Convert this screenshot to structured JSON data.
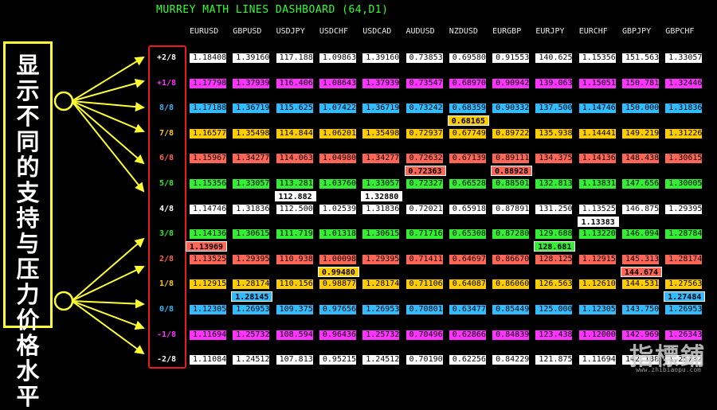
{
  "dashboard": {
    "title": "MURREY MATH LINES DASHBOARD (64,D1)"
  },
  "annotation": {
    "text": "显示不同的支持与压力价格水平"
  },
  "watermark": {
    "text": "指標鋪",
    "sub": "www.zhibiaopu.com"
  },
  "levels": [
    "+2/8",
    "+1/8",
    "8/8",
    "7/8",
    "6/8",
    "5/8",
    "4/8",
    "3/8",
    "2/8",
    "1/8",
    "0/8",
    "-1/8",
    "-2/8"
  ],
  "level_colors": [
    "#ffffff",
    "#ff33ff",
    "#33bbff",
    "#ffcc00",
    "#ff6655",
    "#33ee33",
    "#ffffff",
    "#33ee33",
    "#ff6655",
    "#ffcc00",
    "#33bbff",
    "#ff33ff",
    "#ffffff"
  ],
  "pairs": [
    "EURUSD",
    "GBPUSD",
    "USDJPY",
    "USDCHF",
    "USDCAD",
    "AUDUSD",
    "NZDUSD",
    "EURGBP",
    "EURJPY",
    "EURCHF",
    "GBPJPY",
    "GBPCHF"
  ],
  "grid": [
    [
      "1.18408",
      "1.39160",
      "117.188",
      "1.09863",
      "1.39160",
      "0.73853",
      "0.69580",
      "0.91553",
      "140.625",
      "1.15356",
      "151.563",
      "1.33057"
    ],
    [
      "1.17798",
      "1.37939",
      "116.406",
      "1.08643",
      "1.37939",
      "0.73547",
      "0.68970",
      "0.90942",
      "139.063",
      "1.15051",
      "150.781",
      "1.32446"
    ],
    [
      "1.17188",
      "1.36719",
      "115.625",
      "1.07422",
      "1.36719",
      "0.73242",
      "0.68359",
      "0.90332",
      "137.500",
      "1.14746",
      "150.000",
      "1.31836"
    ],
    [
      "1.16577",
      "1.35498",
      "114.844",
      "1.06201",
      "1.35498",
      "0.72937",
      "0.67749",
      "0.89722",
      "135.938",
      "1.14441",
      "149.219",
      "1.31226"
    ],
    [
      "1.15967",
      "1.34277",
      "114.063",
      "1.04980",
      "1.34277",
      "0.72632",
      "0.67139",
      "0.89111",
      "134.375",
      "1.14136",
      "148.438",
      "1.30615"
    ],
    [
      "1.15356",
      "1.33057",
      "113.281",
      "1.03760",
      "1.33057",
      "0.72327",
      "0.66528",
      "0.88501",
      "132.813",
      "1.13831",
      "147.656",
      "1.30005"
    ],
    [
      "1.14746",
      "1.31836",
      "112.500",
      "1.02539",
      "1.31836",
      "0.72021",
      "0.65918",
      "0.87891",
      "131.250",
      "1.13525",
      "146.875",
      "1.29395"
    ],
    [
      "1.14136",
      "1.30615",
      "111.719",
      "1.01318",
      "1.30615",
      "0.71716",
      "0.65308",
      "0.87280",
      "129.688",
      "1.13220",
      "146.094",
      "1.28784"
    ],
    [
      "1.13525",
      "1.29395",
      "110.938",
      "1.00098",
      "1.29395",
      "0.71411",
      "0.64697",
      "0.86670",
      "128.125",
      "1.12915",
      "145.313",
      "1.28174"
    ],
    [
      "1.12915",
      "1.28174",
      "110.156",
      "0.98877",
      "1.28174",
      "0.71106",
      "0.64087",
      "0.86060",
      "126.563",
      "1.12610",
      "144.531",
      "1.27563"
    ],
    [
      "1.12305",
      "1.26953",
      "109.375",
      "0.97656",
      "1.26953",
      "0.70801",
      "0.63477",
      "0.85449",
      "125.000",
      "1.12305",
      "143.750",
      "1.26953"
    ],
    [
      "1.11694",
      "1.25732",
      "108.594",
      "0.96436",
      "1.25732",
      "0.70496",
      "0.62866",
      "0.84839",
      "123.438",
      "1.12000",
      "142.969",
      "1.26343"
    ],
    [
      "1.11084",
      "1.24512",
      "107.813",
      "0.95215",
      "1.24512",
      "0.70190",
      "0.62256",
      "0.84229",
      "121.875",
      "1.11694",
      "142.188",
      "1.25732"
    ]
  ],
  "current": [
    {
      "col": 0,
      "row": 7,
      "value": "1.13969",
      "color": "#ff6655"
    },
    {
      "col": 1,
      "row": 9,
      "value": "1.28145",
      "color": "#33bbff"
    },
    {
      "col": 2,
      "row": 5,
      "value": "112.882",
      "color": "#ffffff"
    },
    {
      "col": 3,
      "row": 8,
      "value": "0.99480",
      "color": "#ffcc00"
    },
    {
      "col": 4,
      "row": 5,
      "value": "1.32880",
      "color": "#ffffff"
    },
    {
      "col": 5,
      "row": 4,
      "value": "0.72363",
      "color": "#ff6655"
    },
    {
      "col": 6,
      "row": 2,
      "value": "0.68165",
      "color": "#ffcc00"
    },
    {
      "col": 7,
      "row": 4,
      "value": "0.88928",
      "color": "#ff6655"
    },
    {
      "col": 8,
      "row": 7,
      "value": "128.681",
      "color": "#33ee33"
    },
    {
      "col": 9,
      "row": 6,
      "value": "1.13383",
      "color": "#ffffff"
    },
    {
      "col": 10,
      "row": 8,
      "value": "144.674",
      "color": "#ff6655"
    },
    {
      "col": 11,
      "row": 9,
      "value": "1.27484",
      "color": "#33bbff"
    }
  ]
}
